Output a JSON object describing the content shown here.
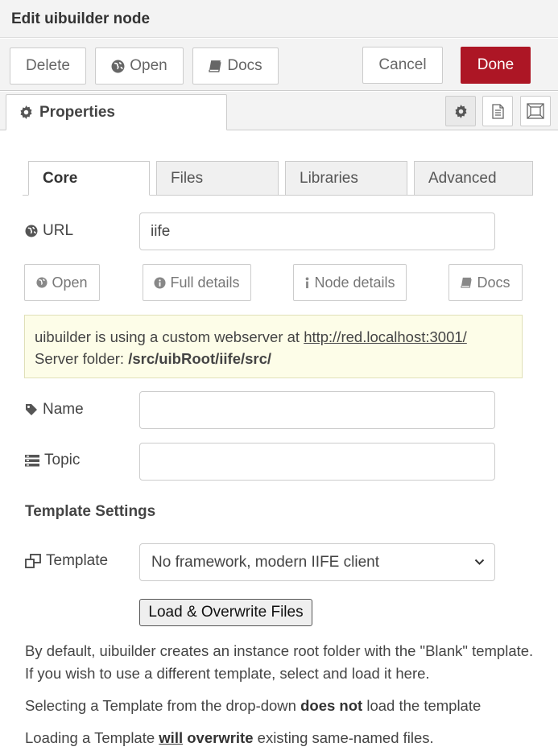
{
  "dialog": {
    "title": "Edit uibuilder node"
  },
  "toolbar": {
    "delete_label": "Delete",
    "open_label": "Open",
    "docs_label": "Docs",
    "cancel_label": "Cancel",
    "done_label": "Done",
    "done_color": "#ad1625"
  },
  "tabs": {
    "properties_label": "Properties"
  },
  "inner_tabs": [
    {
      "label": "Core",
      "active": true
    },
    {
      "label": "Files"
    },
    {
      "label": "Libraries"
    },
    {
      "label": "Advanced"
    }
  ],
  "url": {
    "label": "URL",
    "value": "iife"
  },
  "sub_buttons": {
    "open": "Open",
    "full_details": "Full details",
    "node_details": "Node details",
    "docs": "Docs"
  },
  "info": {
    "line1_prefix": "uibuilder is using a custom webserver at ",
    "line1_link": "http://red.localhost:3001/",
    "line2_prefix": "Server folder: ",
    "line2_path": "/src/uibRoot/iife/src/"
  },
  "name": {
    "label": "Name",
    "value": ""
  },
  "topic": {
    "label": "Topic",
    "value": ""
  },
  "template": {
    "heading": "Template Settings",
    "label": "Template",
    "selected": "No framework, modern IIFE client",
    "load_button": "Load & Overwrite Files"
  },
  "help": {
    "p1": "By default, uibuilder creates an instance root folder with the \"Blank\" template. If you wish to use a different template, select and load it here.",
    "p2_a": "Selecting a Template from the drop-down ",
    "p2_b": "does not",
    "p2_c": " load the template",
    "p3_a": "Loading a Template ",
    "p3_b": "will",
    "p3_c": " overwrite",
    "p3_d": " existing same-named files."
  }
}
